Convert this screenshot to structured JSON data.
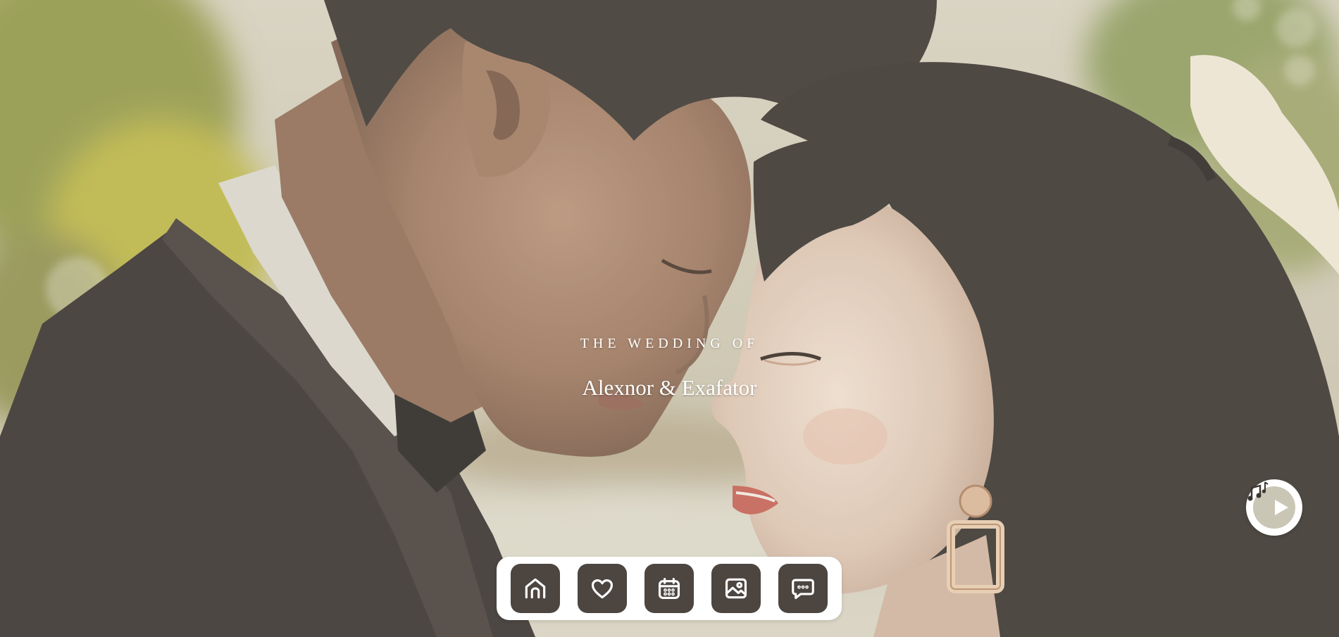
{
  "hero": {
    "subtitle": "THE WEDDING OF",
    "names": "Alexnor & Exafator"
  },
  "nav": {
    "items": [
      {
        "id": "home",
        "icon": "home-icon"
      },
      {
        "id": "couple",
        "icon": "heart-icon"
      },
      {
        "id": "event",
        "icon": "calendar-icon"
      },
      {
        "id": "gallery",
        "icon": "gallery-icon"
      },
      {
        "id": "wishes",
        "icon": "chat-bubble-icon"
      }
    ],
    "active_color": "#4c4540",
    "dock_color": "#ffffff"
  },
  "music": {
    "icon": "play-icon",
    "decoration_icon": "music-notes-icon"
  },
  "photo": {
    "subject": "couple-forehead-to-forehead-photo"
  },
  "colors": {
    "text": "#ffffff",
    "button": "#4c4540",
    "music_inner": "#c9c6b5"
  }
}
